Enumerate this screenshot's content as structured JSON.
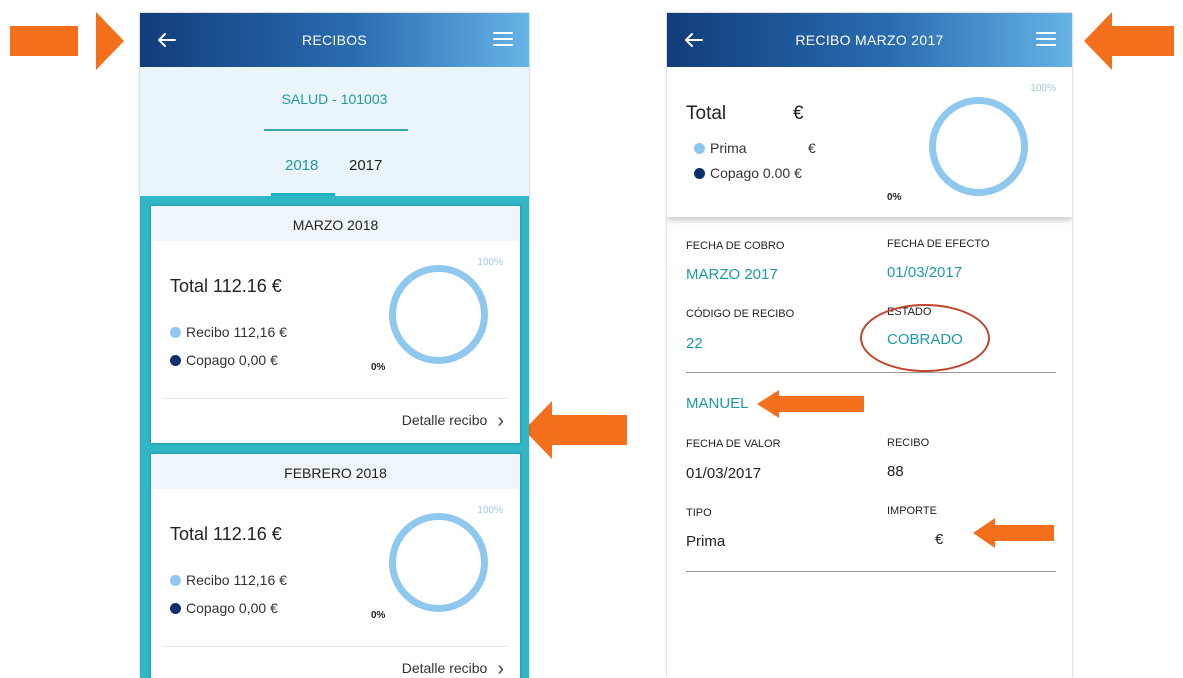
{
  "list_screen": {
    "header": {
      "title": "RECIBOS"
    },
    "product_tab": "SALUD - 101003",
    "years": [
      "2018",
      "2017"
    ],
    "cards": [
      {
        "month": "MARZO 2018",
        "total": "Total 112.16 €",
        "legend_recibo": "Recibo 112,16 €",
        "legend_copago": "Copago 0,00 €",
        "pct_max": "100%",
        "pct_min": "0%",
        "link": "Detalle recibo"
      },
      {
        "month": "FEBRERO 2018",
        "total": "Total 112.16 €",
        "legend_recibo": "Recibo 112,16 €",
        "legend_copago": "Copago 0,00 €",
        "pct_max": "100%",
        "pct_min": "0%",
        "link": "Detalle recibo"
      }
    ]
  },
  "detail_screen": {
    "header": {
      "title": "RECIBO MARZO 2017"
    },
    "summary": {
      "total_label": "Total",
      "total_value": "€",
      "prima_label": "Prima",
      "prima_value": "€",
      "copago": "Copago 0.00 €",
      "pct_max": "100%",
      "pct_min": "0%"
    },
    "fecha_cobro": {
      "label": "FECHA DE COBRO",
      "value": "MARZO 2017"
    },
    "fecha_efecto": {
      "label": "FECHA DE EFECTO",
      "value": "01/03/2017"
    },
    "codigo_recibo": {
      "label": "CÓDIGO DE RECIBO",
      "value": "22"
    },
    "estado": {
      "label": "ESTADO",
      "value": "COBRADO"
    },
    "person": "MANUEL",
    "fecha_valor": {
      "label": "FECHA DE VALOR",
      "value": "01/03/2017"
    },
    "recibo": {
      "label": "RECIBO",
      "value": "88"
    },
    "tipo": {
      "label": "TIPO",
      "value": "Prima"
    },
    "importe": {
      "label": "IMPORTE",
      "value": "€"
    }
  },
  "colors": {
    "header_start": "#123c7a",
    "header_end": "#66b3e6",
    "accent_teal": "#1e9aa5",
    "ring_light": "#8fc8ef",
    "annotation_orange": "#f36f1c",
    "annotation_circle": "#c0452a"
  }
}
